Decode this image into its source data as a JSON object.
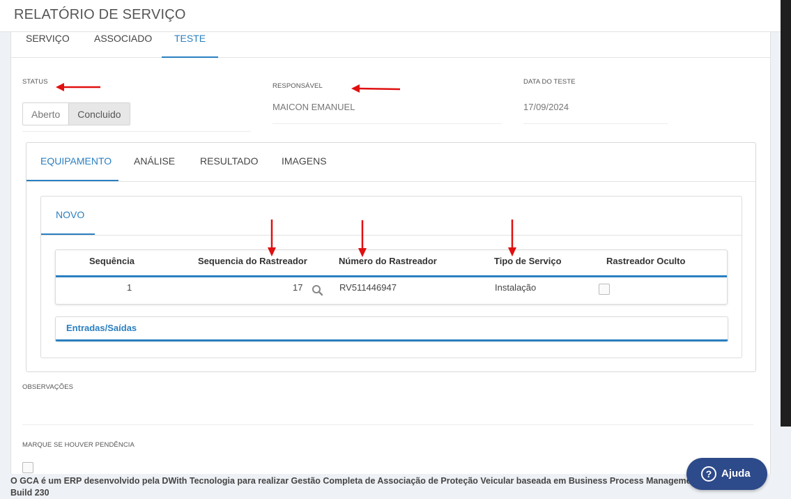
{
  "page": {
    "title": "RELATÓRIO DE SERVIÇO"
  },
  "top_tabs": [
    {
      "label": "SERVIÇO"
    },
    {
      "label": "ASSOCIADO"
    },
    {
      "label": "TESTE",
      "active": true
    }
  ],
  "status": {
    "label": "STATUS",
    "options": [
      "Aberto",
      "Concluido"
    ],
    "selected": "Concluido"
  },
  "responsavel": {
    "label": "RESPONSÁVEL",
    "value": "MAICON EMANUEL"
  },
  "data_teste": {
    "label": "DATA DO TESTE",
    "value": "17/09/2024"
  },
  "inner_tabs": [
    {
      "label": "EQUIPAMENTO",
      "active": true
    },
    {
      "label": "ANÁLISE"
    },
    {
      "label": "RESULTADO"
    },
    {
      "label": "IMAGENS"
    }
  ],
  "novo_tab": {
    "label": "NOVO"
  },
  "grid": {
    "columns": [
      "Sequência",
      "Sequencia do Rastreador",
      "Número do Rastreador",
      "Tipo de Serviço",
      "Rastreador Oculto"
    ],
    "rows": [
      {
        "sequencia": "1",
        "sequencia_rastreador": "17",
        "numero_rastreador": "RV511446947",
        "tipo_servico": "Instalação",
        "rastreador_oculto": false
      }
    ]
  },
  "entradas_saidas": {
    "label": "Entradas/Saídas"
  },
  "observacoes": {
    "label": "OBSERVAÇÕES"
  },
  "pendencia": {
    "label": "MARQUE SE HOUVER PENDÊNCIA",
    "checked": false
  },
  "footer": {
    "text": "O GCA é um ERP desenvolvido pela DWith Tecnologia para realizar Gestão Completa de Associação de Proteção Veicular baseada em Business Process Management. 05-08-2024 - Build 230"
  },
  "help_button": {
    "label": "Ajuda",
    "icon": "question-circle-icon"
  },
  "colors": {
    "accent": "#2a7fc0",
    "annotation_arrow": "#e01010",
    "help_button": "#2d4a8a"
  }
}
